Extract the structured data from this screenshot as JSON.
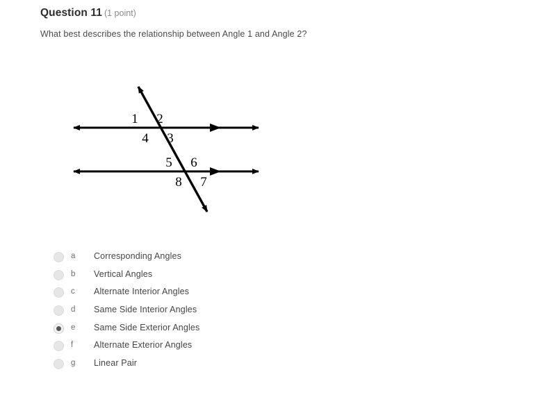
{
  "header": {
    "title": "Question 11",
    "points": "(1 point)"
  },
  "prompt": "What best describes the relationship between Angle 1 and Angle 2?",
  "diagram": {
    "description": "Two parallel horizontal lines cut by a transversal with eight numbered angles",
    "angle_labels": [
      "1",
      "2",
      "4",
      "3",
      "5",
      "6",
      "8",
      "7"
    ],
    "line_color": "#000000"
  },
  "options": [
    {
      "letter": "a",
      "label": "Corresponding Angles",
      "selected": false
    },
    {
      "letter": "b",
      "label": "Vertical Angles",
      "selected": false
    },
    {
      "letter": "c",
      "label": "Alternate Interior Angles",
      "selected": false
    },
    {
      "letter": "d",
      "label": "Same Side Interior Angles",
      "selected": false
    },
    {
      "letter": "e",
      "label": "Same Side Exterior Angles",
      "selected": true
    },
    {
      "letter": "f",
      "label": "Alternate Exterior Angles",
      "selected": false
    },
    {
      "letter": "g",
      "label": "Linear Pair",
      "selected": false
    }
  ]
}
